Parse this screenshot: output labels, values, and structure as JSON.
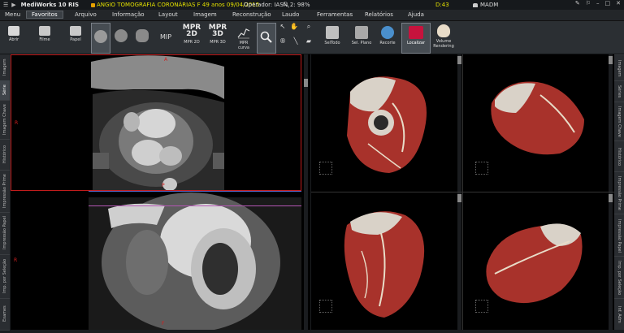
{
  "titlebar": {
    "app_name": "MediWorks 10 RIS",
    "exam_info": "ANGIO TOMOGRAFIA CORONÁRIAS  F 49 anos 09/04/2015",
    "operator": "Operador: IASN",
    "zoom": "2: 98%",
    "time": "D:43",
    "user": "MADM"
  },
  "menubar": {
    "items": [
      "Menu",
      "Favoritos",
      "Arquivo",
      "Informação",
      "Layout",
      "Imagem",
      "Reconstrução",
      "Laudo",
      "Ferramentas",
      "Relatórios",
      "Ajuda"
    ]
  },
  "toolbar": {
    "abrir": "Abrir",
    "filme": "Filme",
    "papel": "Papel",
    "mpr2d_title": "MPR\n2D",
    "mpr2d": "MPR 2D",
    "mpr3d_title": "MPR\n3D",
    "mpr3d": "MPR 3D",
    "mpr_curva": "MPR curva",
    "seltodo": "SelTodo",
    "sel_plano": "Sel. Plano",
    "recorte": "Recorte",
    "localizar": "Localizar",
    "volume_rendering": "Volume Rendering",
    "mip_label": "MIP"
  },
  "left_tabs": [
    "Imagem",
    "Série",
    "Imagem Chave",
    "Histórico",
    "Impressão Prime",
    "Impressão Papel",
    "Imp. por Seleção",
    "Exames"
  ],
  "right_tabs": [
    "Imagem",
    "Séries",
    "Imagem Chave",
    "Histórico",
    "Impressão Prime",
    "Impressão Papel",
    "Imp. por Seleção",
    "Inf. Adm"
  ],
  "viewer": {
    "axial_top_label": "A",
    "axial_left_label": "R",
    "orientation_p": "P",
    "orientation_h": "H",
    "short_axis_left_label": "R",
    "short_axis_bottom_label": "F"
  },
  "colors": {
    "accent": "#d42020",
    "selection": "#5a5f64",
    "heart_red": "#a8322b",
    "heart_white": "#d9d2c8",
    "localizar_bg": "#c7133d"
  }
}
